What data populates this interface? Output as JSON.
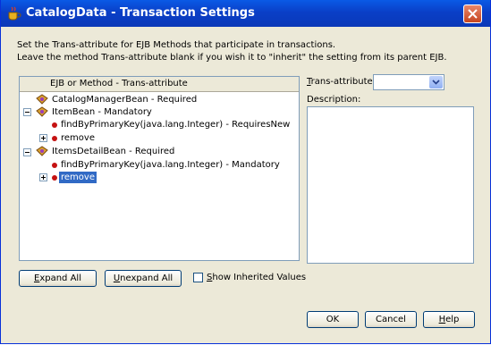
{
  "window": {
    "title": "CatalogData - Transaction Settings",
    "icons": {
      "app": "coffee-cup-icon",
      "close": "close-icon"
    }
  },
  "instructions": {
    "line1": "Set the Trans-attribute for EJB Methods that participate in transactions.",
    "line2": "Leave the method Trans-attribute blank if you wish it to \"inherit\" the setting from its parent EJB."
  },
  "tree": {
    "header": "EJB or Method   -   Trans-attribute",
    "nodes": [
      {
        "text": "CatalogManagerBean   -   Required",
        "kind": "bean"
      },
      {
        "text": "ItemBean   -   Mandatory",
        "kind": "bean"
      },
      {
        "text": "findByPrimaryKey(java.lang.Integer)   -   RequiresNew",
        "kind": "method"
      },
      {
        "text": "remove",
        "kind": "method"
      },
      {
        "text": "ItemsDetailBean   -   Required",
        "kind": "bean"
      },
      {
        "text": "findByPrimaryKey(java.lang.Integer)   -   Mandatory",
        "kind": "method"
      },
      {
        "text": "remove",
        "kind": "method",
        "selected": true
      }
    ]
  },
  "trans_attribute": {
    "label_u": "T",
    "label_rest": "rans-attribute:",
    "value": ""
  },
  "description": {
    "label": "Description:",
    "value": ""
  },
  "buttons": {
    "expand_all_u": "E",
    "expand_all_rest": "xpand All",
    "unexpand_all_u": "U",
    "unexpand_all_rest": "nexpand All",
    "show_inherited_u": "S",
    "show_inherited_rest": "how Inherited Values",
    "ok": "OK",
    "cancel": "Cancel",
    "help_u": "H",
    "help_rest": "elp"
  },
  "colors": {
    "titlebar": "#0a3fc7",
    "selection": "#316ac5",
    "face": "#ece9d8"
  }
}
